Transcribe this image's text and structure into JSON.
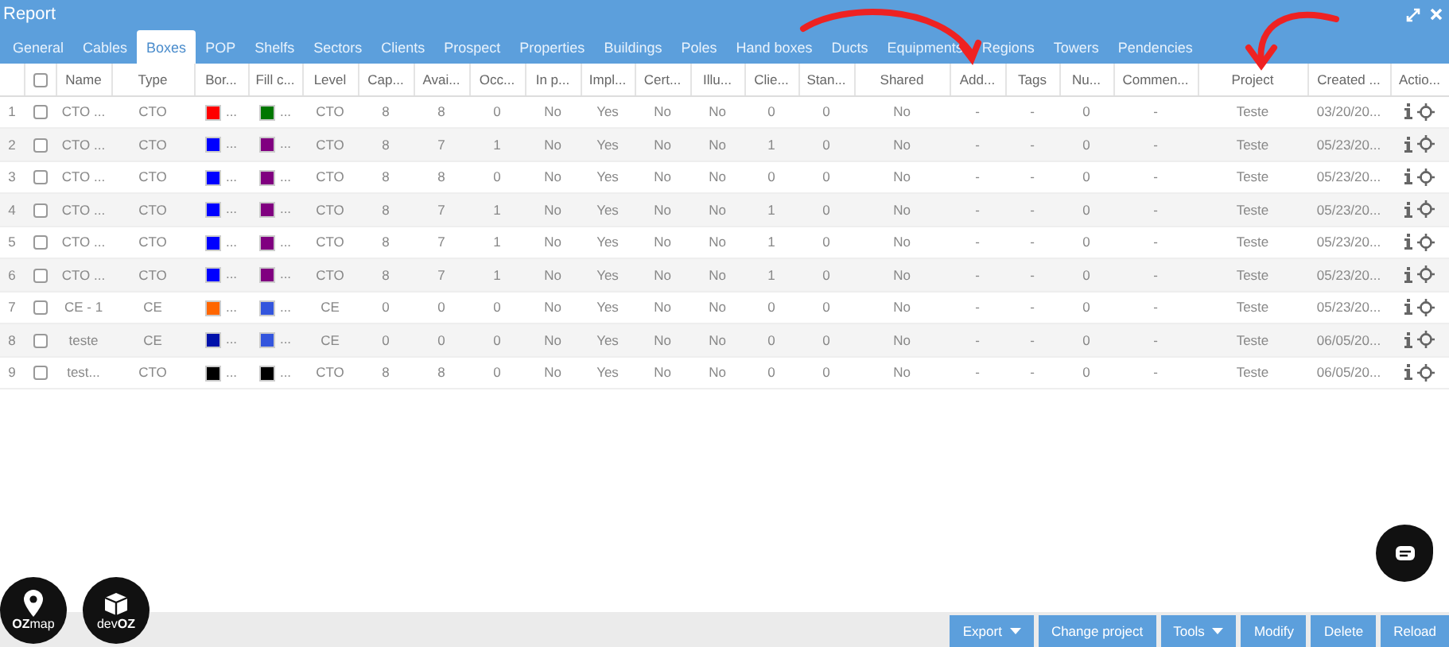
{
  "window": {
    "title": "Report"
  },
  "tabs": [
    {
      "label": "General",
      "selected": false
    },
    {
      "label": "Cables",
      "selected": false
    },
    {
      "label": "Boxes",
      "selected": true
    },
    {
      "label": "POP",
      "selected": false
    },
    {
      "label": "Shelfs",
      "selected": false
    },
    {
      "label": "Sectors",
      "selected": false
    },
    {
      "label": "Clients",
      "selected": false
    },
    {
      "label": "Prospect",
      "selected": false
    },
    {
      "label": "Properties",
      "selected": false
    },
    {
      "label": "Buildings",
      "selected": false
    },
    {
      "label": "Poles",
      "selected": false
    },
    {
      "label": "Hand boxes",
      "selected": false
    },
    {
      "label": "Ducts",
      "selected": false
    },
    {
      "label": "Equipments",
      "selected": false
    },
    {
      "label": "Regions",
      "selected": false
    },
    {
      "label": "Towers",
      "selected": false
    },
    {
      "label": "Pendencies",
      "selected": false
    }
  ],
  "table": {
    "header_checked": false,
    "columns": [
      "Name",
      "Type",
      "Bor...",
      "Fill c...",
      "Level",
      "Cap...",
      "Avai...",
      "Occ...",
      "In p...",
      "Impl...",
      "Cert...",
      "Illu...",
      "Clie...",
      "Stan...",
      "Shared",
      "Add...",
      "Tags",
      "Nu...",
      "Commen...",
      "Project",
      "Created ...",
      "Actio..."
    ],
    "rows": [
      {
        "index": "1",
        "checked": false,
        "cells": [
          "CTO ...",
          "CTO",
          {
            "color": "#ff0000",
            "text": "..."
          },
          {
            "color": "#007700",
            "text": "..."
          },
          "CTO",
          "8",
          "8",
          "0",
          "No",
          "Yes",
          "No",
          "No",
          "0",
          "0",
          "No",
          "-",
          "-",
          "0",
          "-",
          "Teste",
          "03/20/20..."
        ]
      },
      {
        "index": "2",
        "checked": false,
        "cells": [
          "CTO ...",
          "CTO",
          {
            "color": "#0000ff",
            "text": "..."
          },
          {
            "color": "#800080",
            "text": "..."
          },
          "CTO",
          "8",
          "7",
          "1",
          "No",
          "Yes",
          "No",
          "No",
          "1",
          "0",
          "No",
          "-",
          "-",
          "0",
          "-",
          "Teste",
          "05/23/20..."
        ]
      },
      {
        "index": "3",
        "checked": false,
        "cells": [
          "CTO ...",
          "CTO",
          {
            "color": "#0000ff",
            "text": "..."
          },
          {
            "color": "#800080",
            "text": "..."
          },
          "CTO",
          "8",
          "8",
          "0",
          "No",
          "Yes",
          "No",
          "No",
          "0",
          "0",
          "No",
          "-",
          "-",
          "0",
          "-",
          "Teste",
          "05/23/20..."
        ]
      },
      {
        "index": "4",
        "checked": false,
        "cells": [
          "CTO ...",
          "CTO",
          {
            "color": "#0000ff",
            "text": "..."
          },
          {
            "color": "#800080",
            "text": "..."
          },
          "CTO",
          "8",
          "7",
          "1",
          "No",
          "Yes",
          "No",
          "No",
          "1",
          "0",
          "No",
          "-",
          "-",
          "0",
          "-",
          "Teste",
          "05/23/20..."
        ]
      },
      {
        "index": "5",
        "checked": false,
        "cells": [
          "CTO ...",
          "CTO",
          {
            "color": "#0000ff",
            "text": "..."
          },
          {
            "color": "#800080",
            "text": "..."
          },
          "CTO",
          "8",
          "7",
          "1",
          "No",
          "Yes",
          "No",
          "No",
          "1",
          "0",
          "No",
          "-",
          "-",
          "0",
          "-",
          "Teste",
          "05/23/20..."
        ]
      },
      {
        "index": "6",
        "checked": false,
        "cells": [
          "CTO ...",
          "CTO",
          {
            "color": "#0000ff",
            "text": "..."
          },
          {
            "color": "#800080",
            "text": "..."
          },
          "CTO",
          "8",
          "7",
          "1",
          "No",
          "Yes",
          "No",
          "No",
          "1",
          "0",
          "No",
          "-",
          "-",
          "0",
          "-",
          "Teste",
          "05/23/20..."
        ]
      },
      {
        "index": "7",
        "checked": false,
        "cells": [
          "CE - 1",
          "CE",
          {
            "color": "#ff6600",
            "text": "..."
          },
          {
            "color": "#3355dd",
            "text": "..."
          },
          "CE",
          "0",
          "0",
          "0",
          "No",
          "Yes",
          "No",
          "No",
          "0",
          "0",
          "No",
          "-",
          "-",
          "0",
          "-",
          "Teste",
          "05/23/20..."
        ]
      },
      {
        "index": "8",
        "checked": false,
        "cells": [
          "teste",
          "CE",
          {
            "color": "#0011aa",
            "text": "..."
          },
          {
            "color": "#3355dd",
            "text": "..."
          },
          "CE",
          "0",
          "0",
          "0",
          "No",
          "Yes",
          "No",
          "No",
          "0",
          "0",
          "No",
          "-",
          "-",
          "0",
          "-",
          "Teste",
          "06/05/20..."
        ]
      },
      {
        "index": "9",
        "checked": false,
        "cells": [
          "test...",
          "CTO",
          {
            "color": "#000000",
            "text": "..."
          },
          {
            "color": "#000000",
            "text": "..."
          },
          "CTO",
          "8",
          "8",
          "0",
          "No",
          "Yes",
          "No",
          "No",
          "0",
          "0",
          "No",
          "-",
          "-",
          "0",
          "-",
          "Teste",
          "06/05/20..."
        ]
      }
    ]
  },
  "logos": [
    {
      "kind": "map",
      "label": "**OZ**map"
    },
    {
      "kind": "cube",
      "label": "dev**OZ**"
    }
  ],
  "buttons": [
    {
      "label": "Export",
      "dropdown": true
    },
    {
      "label": "Change project",
      "dropdown": false
    },
    {
      "label": "Tools",
      "dropdown": true
    },
    {
      "label": "Modify",
      "dropdown": false
    },
    {
      "label": "Delete",
      "dropdown": false
    },
    {
      "label": "Reload",
      "dropdown": false
    }
  ]
}
